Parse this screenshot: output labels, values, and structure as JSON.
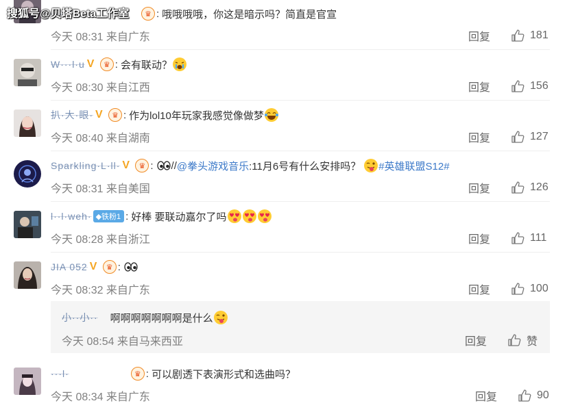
{
  "watermark": "搜狐号@贝塔Beta工作室",
  "comments": [
    {
      "username": "···",
      "text": "哦哦哦哦，你这是暗示吗？简直是官宣",
      "time": "今天 08:31 来自广东",
      "reply": "回复",
      "likes": "181"
    },
    {
      "username": "W···l·u",
      "text": "会有联动？",
      "time": "今天 08:30 来自江西",
      "reply": "回复",
      "likes": "156"
    },
    {
      "username": "扒·大·眼·",
      "text": "作为lol10年玩家我感觉像做梦",
      "time": "今天 08:40 来自湖南",
      "reply": "回复",
      "likes": "127"
    },
    {
      "username": "Sparkling·L·ll·",
      "text_prefix": "//",
      "mention": "@拳头游戏音乐",
      "text": ":11月6号有什么安排吗？",
      "hashtag": "#英雄联盟S12#",
      "time": "今天 08:31 来自美国",
      "reply": "回复",
      "likes": "126"
    },
    {
      "username": "l··l·weh·",
      "fan_label": "铁粉1",
      "text": "好棒 要联动嘉尔了吗",
      "time": "今天 08:28 来自浙江",
      "reply": "回复",
      "likes": "111"
    },
    {
      "username": "JIA 052",
      "text": "",
      "time": "今天 08:32 来自广东",
      "reply": "回复",
      "likes": "100"
    },
    {
      "username": "···l·",
      "text": "可以剧透下表演形式和选曲吗？",
      "time": "今天 08:34 来自广东",
      "reply": "回复",
      "likes": "90"
    }
  ],
  "subreply": {
    "username": "小··小··",
    "text": "啊啊啊啊啊啊啊是什么",
    "time": "今天 08:54 来自马来西亚",
    "reply": "回复",
    "likes": "赞"
  },
  "colors": {
    "link": "#3d7ac9",
    "meta": "#808080",
    "subbox_bg": "#f5f5f5"
  }
}
